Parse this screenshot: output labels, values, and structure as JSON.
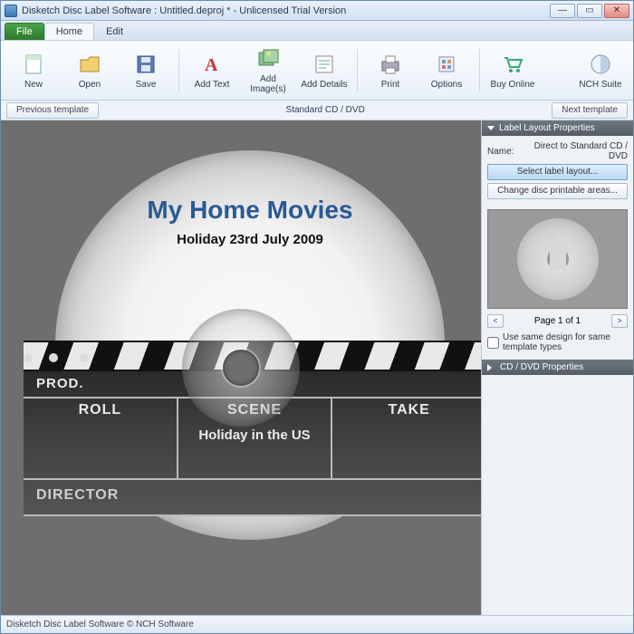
{
  "window": {
    "title": "Disketch Disc Label Software : Untitled.deproj * - Unlicensed Trial Version"
  },
  "menu": {
    "file": "File",
    "home": "Home",
    "edit": "Edit"
  },
  "ribbon": {
    "new": "New",
    "open": "Open",
    "save": "Save",
    "add_text": "Add Text",
    "add_images": "Add Image(s)",
    "add_details": "Add Details",
    "print": "Print",
    "options": "Options",
    "buy_online": "Buy Online",
    "nch_suite": "NCH Suite"
  },
  "template_bar": {
    "prev": "Previous template",
    "title": "Standard CD / DVD",
    "next": "Next template"
  },
  "disc": {
    "title": "My Home Movies",
    "subtitle": "Holiday 23rd July 2009",
    "clap": {
      "prod": "PROD.",
      "roll": "ROLL",
      "scene": "SCENE",
      "take": "TAKE",
      "scene_value": "Holiday in the US",
      "director": "DIRECTOR"
    }
  },
  "right_panel": {
    "layout_header": "Label Layout Properties",
    "name_label": "Name:",
    "name_value": "Direct to Standard CD / DVD",
    "select_layout": "Select label layout...",
    "change_areas": "Change disc printable areas...",
    "page_prev": "<",
    "page_label": "Page 1 of 1",
    "page_next": ">",
    "use_same": "Use same design for same template types",
    "cd_header": "CD / DVD Properties"
  },
  "statusbar": {
    "text": "Disketch Disc Label Software © NCH Software"
  }
}
